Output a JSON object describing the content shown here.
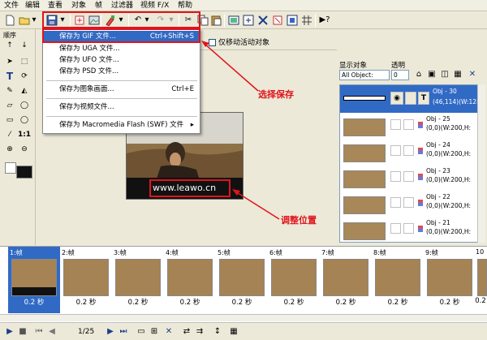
{
  "menubar": {
    "items": [
      "文件",
      "编辑",
      "查看",
      "对象",
      "帧",
      "过滤器",
      "视频 F/X",
      "帮助"
    ]
  },
  "toolbar": {
    "icons": [
      "new-icon",
      "open-icon",
      "save-icon",
      "dropdown-arrow-icon",
      "export-icon",
      "export2-icon",
      "paint-icon",
      "undo-icon",
      "redo-icon",
      "cut-icon",
      "copy-icon",
      "paste-icon",
      "frame-icon",
      "delete-icon",
      "crop-icon",
      "resize-icon",
      "grid-icon",
      "help-icon"
    ]
  },
  "tools_panel": {
    "label": "顺序"
  },
  "save_menu": {
    "items": [
      {
        "label": "保存为 GIF 文件...",
        "shortcut": "Ctrl+Shift+S"
      },
      {
        "label": "保存为 UGA 文件...",
        "shortcut": ""
      },
      {
        "label": "保存为 UFO 文件...",
        "shortcut": ""
      },
      {
        "label": "保存为 PSD 文件...",
        "shortcut": ""
      },
      {
        "label": "保存为图象画面...",
        "shortcut": "Ctrl+E"
      },
      {
        "label": "保存为视频文件...",
        "shortcut": ""
      },
      {
        "label": "保存为 Macromedia Flash (SWF) 文件",
        "shortcut": "▸"
      }
    ]
  },
  "canvas": {
    "move_only_checkbox": "仅移动活动对象",
    "watermark_text": "www.leawo.cn"
  },
  "annotations": {
    "save": "选择保存",
    "position": "调整位置"
  },
  "objects_panel": {
    "show_label": "显示对象",
    "opacity_label": "透明",
    "show_select": "All Object:",
    "opacity_value": "0",
    "objects": [
      {
        "name": "Obj - 30",
        "info": "(46,114)(W:128"
      },
      {
        "name": "Obj - 25",
        "info": "(0,0)(W:200,H:"
      },
      {
        "name": "Obj - 24",
        "info": "(0,0)(W:200,H:"
      },
      {
        "name": "Obj - 23",
        "info": "(0,0)(W:200,H:"
      },
      {
        "name": "Obj - 22",
        "info": "(0,0)(W:200,H:"
      },
      {
        "name": "Obj - 21",
        "info": "(0,0)(W:200,H:"
      }
    ]
  },
  "frames": [
    {
      "label": "1:帧",
      "delay": "0.2 秒"
    },
    {
      "label": "2:帧",
      "delay": "0.2 秒"
    },
    {
      "label": "3:帧",
      "delay": "0.2 秒"
    },
    {
      "label": "4:帧",
      "delay": "0.2 秒"
    },
    {
      "label": "5:帧",
      "delay": "0.2 秒"
    },
    {
      "label": "6:帧",
      "delay": "0.2 秒"
    },
    {
      "label": "7:帧",
      "delay": "0.2 秒"
    },
    {
      "label": "8:帧",
      "delay": "0.2 秒"
    },
    {
      "label": "9:帧",
      "delay": "0.2 秒"
    },
    {
      "label": "10",
      "delay": "0.2"
    }
  ],
  "statusbar": {
    "frame_counter": "1/25"
  },
  "colors": {
    "accent": "#e0141c",
    "selection": "#316ac5"
  }
}
